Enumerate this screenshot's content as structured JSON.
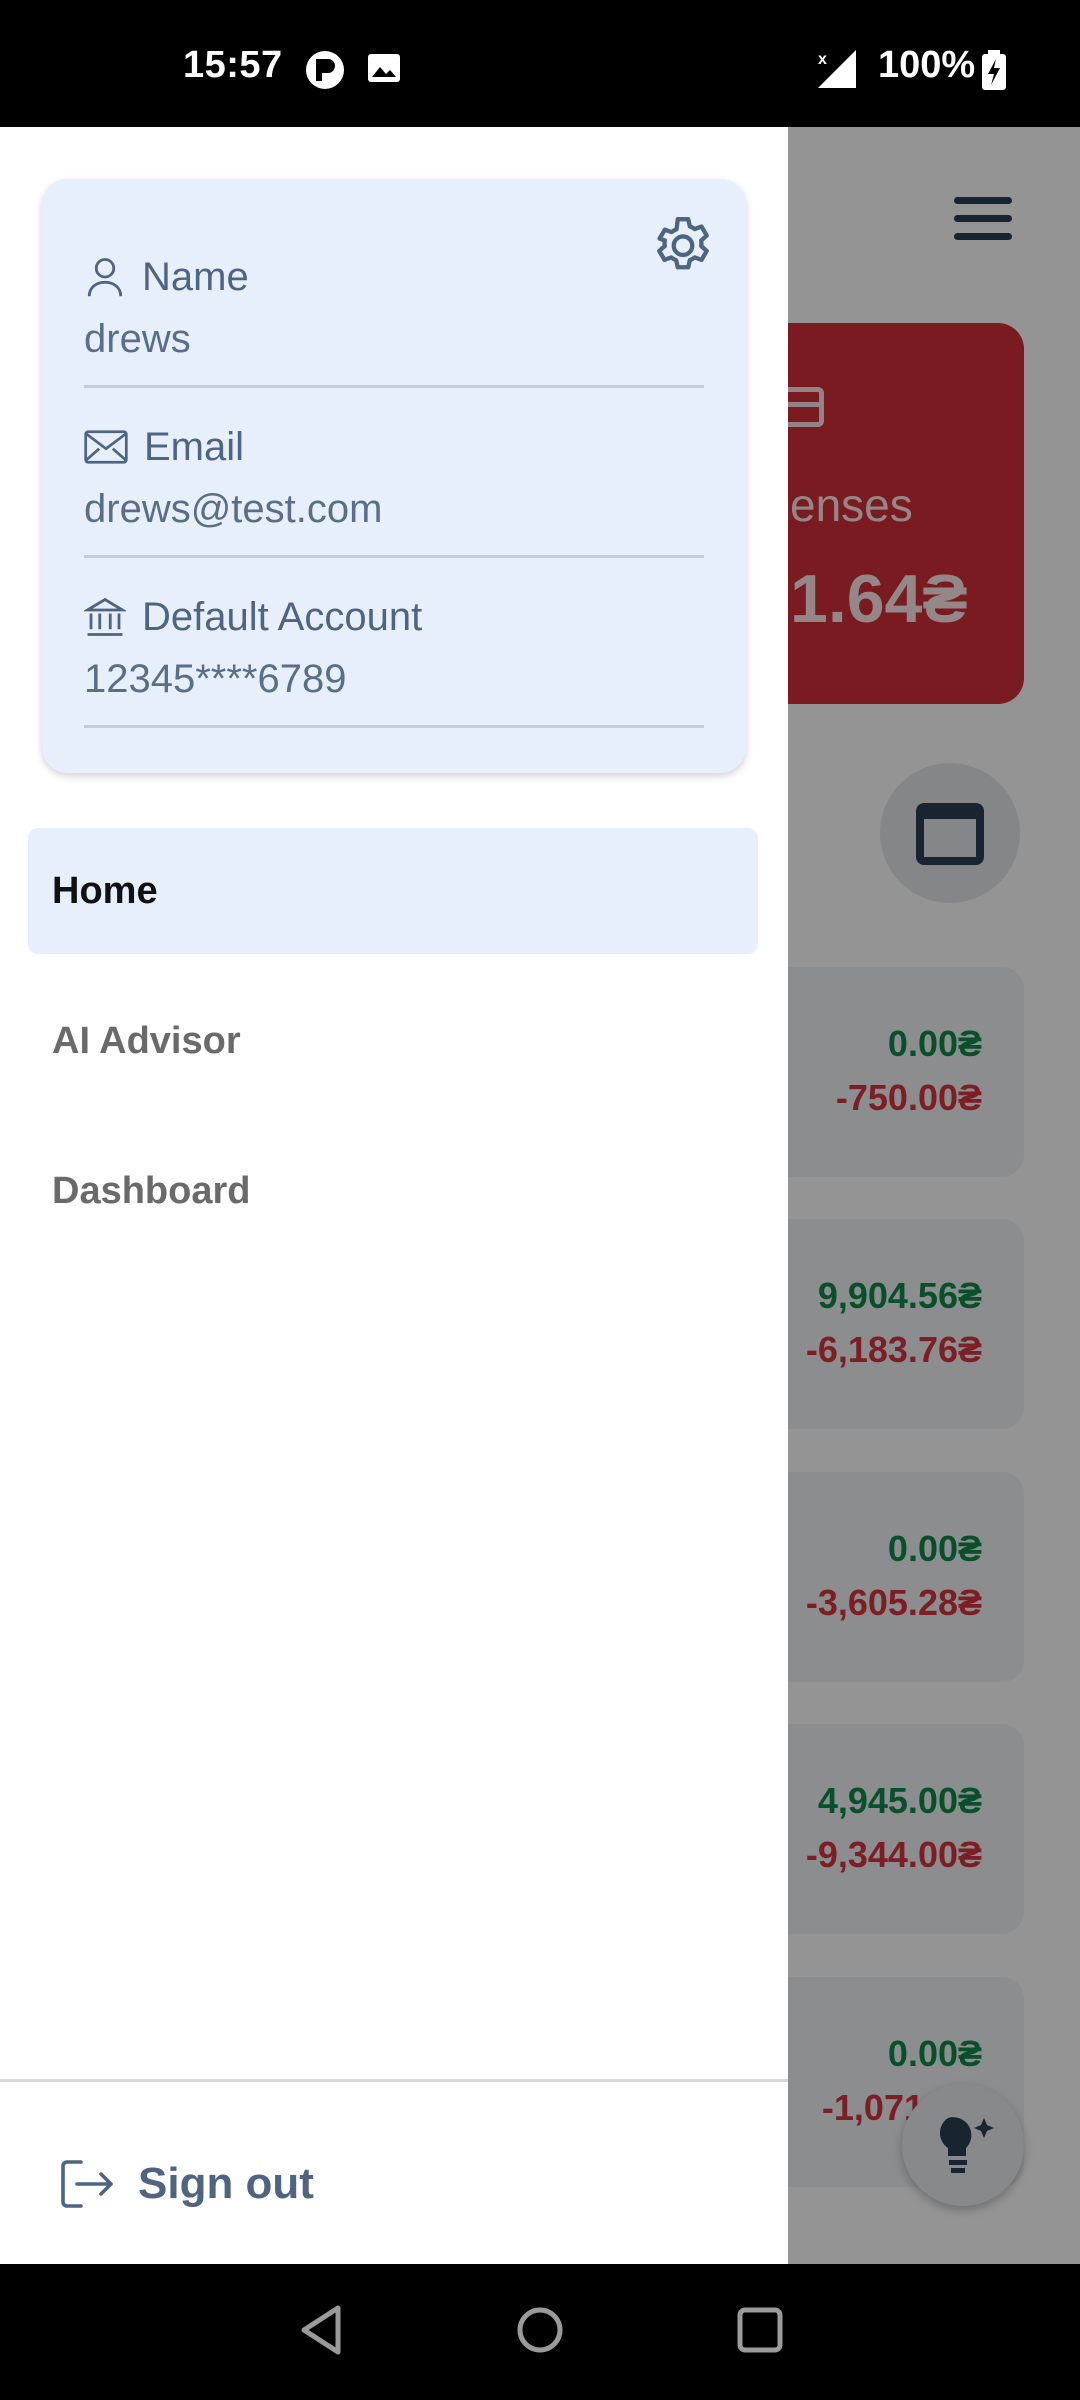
{
  "status_bar": {
    "time": "15:57",
    "battery": "100%",
    "icons": [
      "pi-app-icon",
      "image-icon",
      "signal-icon",
      "battery-charging-icon"
    ]
  },
  "background": {
    "expense_label": "enses",
    "expense_amount": "1.64₴",
    "transactions": [
      {
        "income": "0.00₴",
        "expense": "-750.00₴"
      },
      {
        "income": "9,904.56₴",
        "expense": "-6,183.76₴"
      },
      {
        "income": "0.00₴",
        "expense": "-3,605.28₴"
      },
      {
        "income": "4,945.00₴",
        "expense": "-9,344.00₴"
      },
      {
        "income": "0.00₴",
        "expense": "-1,071."
      }
    ],
    "colors": {
      "expense_card": "#d32f3a",
      "income": "#0e8a4a",
      "expense": "#d8343f"
    }
  },
  "drawer": {
    "profile": {
      "name_label": "Name",
      "name_value": "drews",
      "email_label": "Email",
      "email_value": "drews@test.com",
      "account_label": "Default Account",
      "account_value": "12345****6789"
    },
    "nav_items": [
      {
        "label": "Home",
        "active": true
      },
      {
        "label": "AI Advisor",
        "active": false
      },
      {
        "label": "Dashboard",
        "active": false
      }
    ],
    "signout_label": "Sign out",
    "colors": {
      "card_bg": "#e7effc",
      "accent": "#4e6482"
    }
  },
  "system_nav": [
    "back-icon",
    "home-icon",
    "recents-icon"
  ]
}
